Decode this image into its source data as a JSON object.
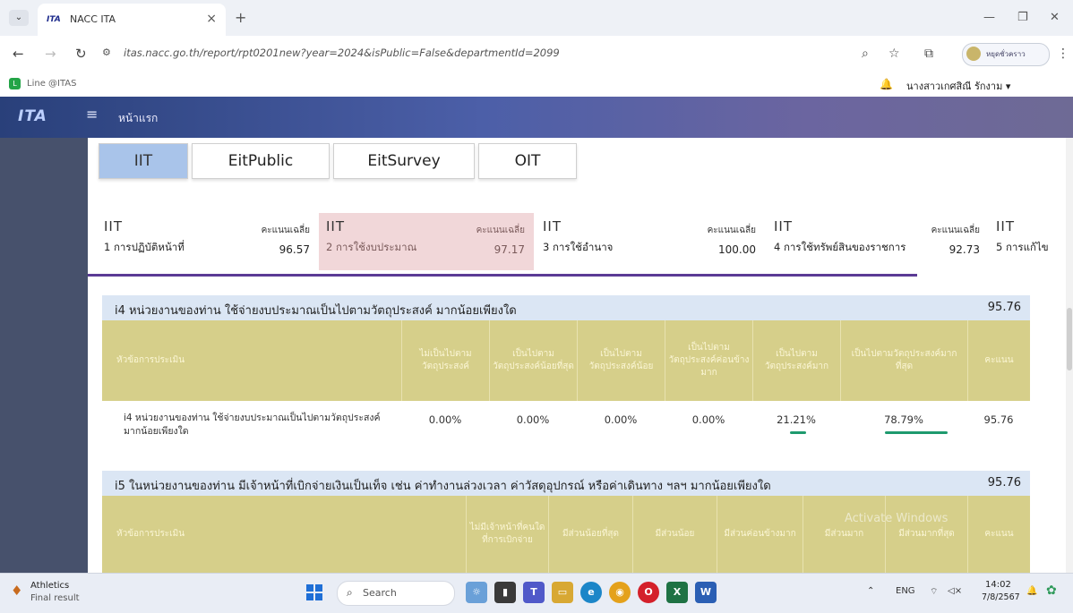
{
  "browser": {
    "tab_title": "NACC ITA",
    "url": "itas.nacc.go.th/report/rpt0201new?year=2024&isPublic=False&departmentId=2099",
    "bookmark": "Line @ITAS",
    "profile_button": "หยุดชั่วคราว"
  },
  "header": {
    "logo": "ITA",
    "home": "หน้าแรก",
    "user": "นางสาวเกศสิณี รักงาม ▾"
  },
  "tabs": [
    "IIT",
    "EitPublic",
    "EitSurvey",
    "OIT"
  ],
  "summary": [
    {
      "head": "IIT",
      "label": "1 การปฏิบัติหน้าที่",
      "score_label": "คะแนนเฉลี่ย",
      "score": "96.57"
    },
    {
      "head": "IIT",
      "label": "2 การใช้งบประมาณ",
      "score_label": "คะแนนเฉลี่ย",
      "score": "97.17"
    },
    {
      "head": "IIT",
      "label": "3 การใช้อำนาจ",
      "score_label": "คะแนนเฉลี่ย",
      "score": "100.00"
    },
    {
      "head": "IIT",
      "label": "4 การใช้ทรัพย์สินของราชการ",
      "score_label": "คะแนนเฉลี่ย",
      "score": "92.73"
    },
    {
      "head": "IIT",
      "label": "5 การแก้ไข"
    }
  ],
  "i4": {
    "title": "i4 หน่วยงานของท่าน ใช้จ่ายงบประมาณเป็นไปตามวัตถุประสงค์ มากน้อยเพียงใด",
    "score": "95.76",
    "headers": [
      "หัวข้อการประเมิน",
      "ไม่เป็นไปตามวัตถุประสงค์",
      "เป็นไปตามวัตถุประสงค์น้อยที่สุด",
      "เป็นไปตามวัตถุประสงค์น้อย",
      "เป็นไปตามวัตถุประสงค์ค่อนข้างมาก",
      "เป็นไปตามวัตถุประสงค์มาก",
      "เป็นไปตามวัตถุประสงค์มากที่สุด",
      "คะแนน"
    ],
    "row": {
      "question": "i4 หน่วยงานของท่าน ใช้จ่ายงบประมาณเป็นไปตามวัตถุประสงค์ มากน้อยเพียงใด",
      "values": [
        "0.00%",
        "0.00%",
        "0.00%",
        "0.00%",
        "21.21%",
        "78.79%",
        "95.76"
      ]
    }
  },
  "i5": {
    "title": "i5 ในหน่วยงานของท่าน มีเจ้าหน้าที่เบิกจ่ายเงินเป็นเท็จ เช่น ค่าทำงานล่วงเวลา ค่าวัสดุอุปกรณ์ หรือค่าเดินทาง ฯลฯ มากน้อยเพียงใด",
    "score": "95.76",
    "headers": [
      "หัวข้อการประเมิน",
      "ไม่มีเจ้าหน้าที่คนใดที่การเบิกจ่าย",
      "มีส่วนน้อยที่สุด",
      "มีส่วนน้อย",
      "มีส่วนค่อนข้างมาก",
      "มีส่วนมาก",
      "มีส่วนมากที่สุด",
      "คะแนน"
    ]
  },
  "watermark": "Activate Windows",
  "taskbar": {
    "weather_title": "Athletics",
    "weather_sub": "Final result",
    "search": "Search",
    "lang": "ENG",
    "time": "14:02",
    "date": "7/8/2567"
  }
}
